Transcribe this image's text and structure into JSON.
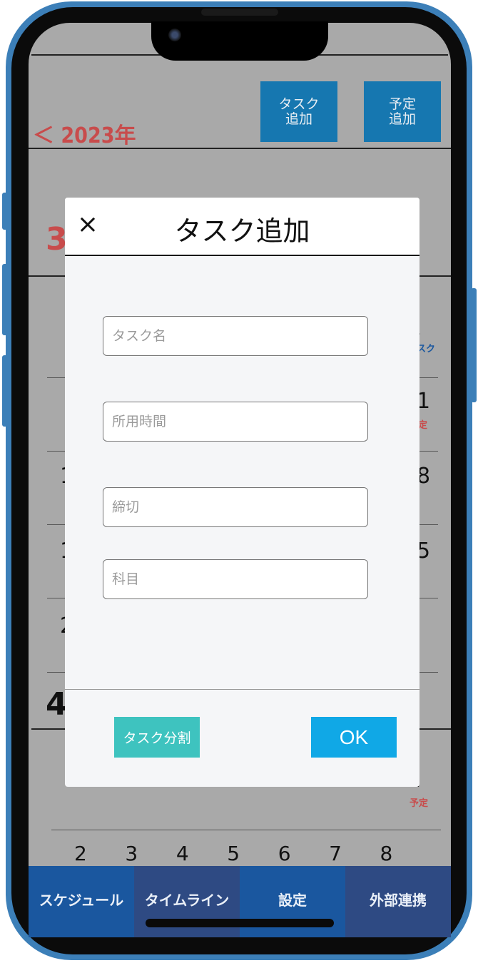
{
  "header": {
    "year_back": "＜ 2023年",
    "add_task_button": "タスク\n追加",
    "add_event_button": "予定\n追加"
  },
  "calendar": {
    "month_current": "3",
    "month_next": "4",
    "right_edge_values": [
      "．",
      "スク",
      "1",
      "定",
      "8",
      "5",
      "]",
      "予定"
    ],
    "left_edge_values": [
      "1",
      "1",
      "2"
    ],
    "week_days": [
      "2",
      "3",
      "4",
      "5",
      "6",
      "7",
      "8"
    ]
  },
  "modal": {
    "title": "タスク追加",
    "close_glyph": "×",
    "fields": [
      {
        "placeholder": "タスク名",
        "value": ""
      },
      {
        "placeholder": "所用時間",
        "value": ""
      },
      {
        "placeholder": "締切",
        "value": ""
      },
      {
        "placeholder": "科目",
        "value": ""
      }
    ],
    "split_button": "タスク分割",
    "ok_button": "OK"
  },
  "tabbar": {
    "tabs": [
      {
        "label": "スケジュール"
      },
      {
        "label": "タイムライン"
      },
      {
        "label": "設定"
      },
      {
        "label": "外部連携"
      }
    ]
  },
  "colors": {
    "frame": "#3c7fb8",
    "accent_red": "#c84c4c",
    "header_button": "#1677b0",
    "split_button": "#3ec3bf",
    "ok_button": "#10a8e6",
    "tab_main": "#1a579f",
    "tab_alt": "#2e4a83"
  }
}
